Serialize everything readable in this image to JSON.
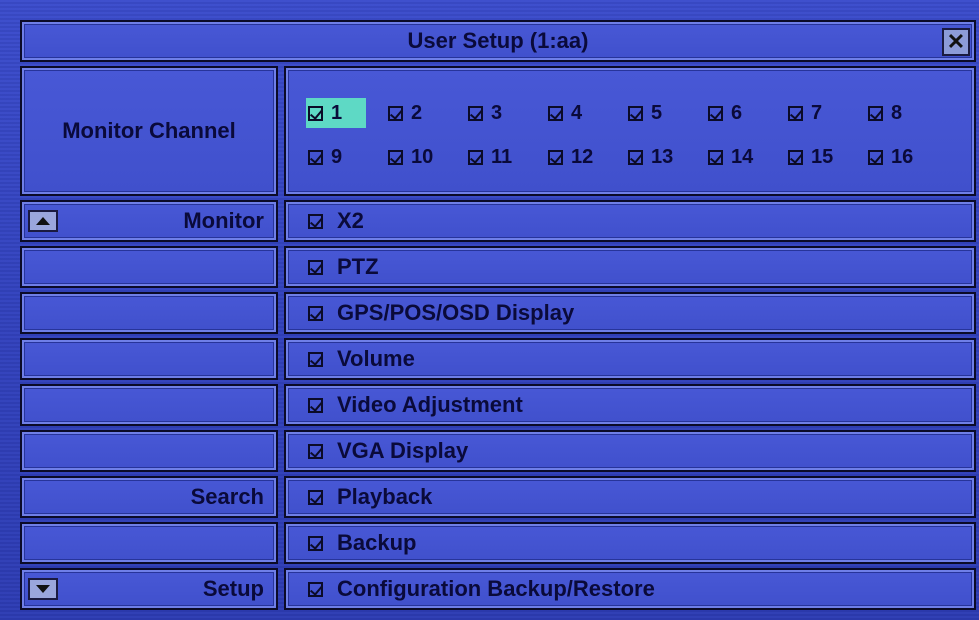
{
  "title": "User Setup (1:aa)",
  "close_icon": "close-icon",
  "monitor_channel": {
    "label": "Monitor Channel",
    "channels": [
      "1",
      "2",
      "3",
      "4",
      "5",
      "6",
      "7",
      "8",
      "9",
      "10",
      "11",
      "12",
      "13",
      "14",
      "15",
      "16"
    ],
    "selected": "1"
  },
  "sections": {
    "monitor": "Monitor",
    "search": "Search",
    "setup": "Setup"
  },
  "permissions": [
    "X2",
    "PTZ",
    "GPS/POS/OSD Display",
    "Volume",
    "Video Adjustment",
    "VGA Display",
    "Playback",
    "Backup",
    "Configuration Backup/Restore"
  ],
  "icons": {
    "scroll_up": "arrow-up-icon",
    "scroll_down": "arrow-down-icon",
    "check": "check-icon"
  },
  "colors": {
    "background": "#3b4ccc",
    "highlight": "#5ed9c5",
    "border": "#0b0b28"
  }
}
